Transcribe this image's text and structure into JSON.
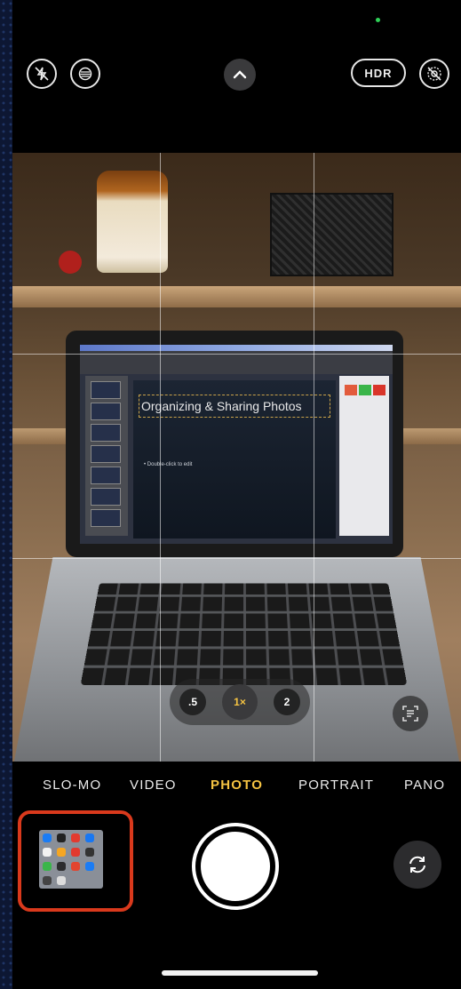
{
  "top_bar": {
    "flash_icon": "flash-off-icon",
    "live_icon": "live-photo-icon",
    "chevron_icon": "chevron-up-icon",
    "hdr_label": "HDR",
    "live_off_icon": "live-off-icon"
  },
  "viewfinder": {
    "slide_title": "Organizing & Sharing Photos",
    "slide_bullet": "• Double-click to edit"
  },
  "zoom": {
    "options": [
      ".5",
      "1×",
      "2"
    ],
    "selected": "1×",
    "text_scan_icon": "live-text-icon"
  },
  "modes": [
    "SLO-MO",
    "VIDEO",
    "PHOTO",
    "PORTRAIT",
    "PANO"
  ],
  "active_mode": "PHOTO",
  "controls": {
    "thumbnail_icon": "last-photo-thumbnail",
    "shutter_icon": "shutter-button",
    "flip_icon": "camera-flip-icon"
  },
  "colors": {
    "accent": "#f5c342",
    "highlight_border": "#d9391c"
  }
}
